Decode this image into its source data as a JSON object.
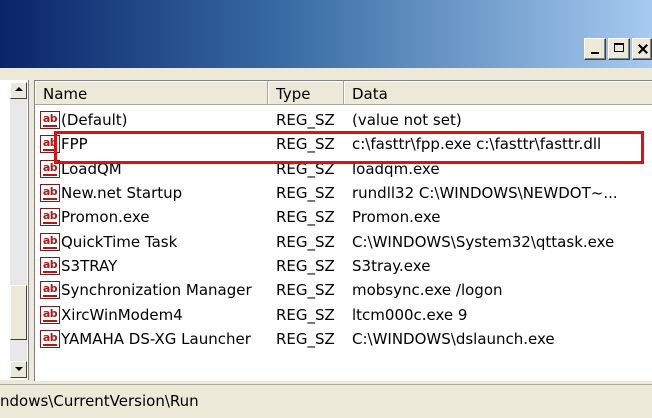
{
  "window": {
    "caption_buttons": [
      "minimize",
      "maximize",
      "close"
    ]
  },
  "list": {
    "columns": [
      "Name",
      "Type",
      "Data"
    ],
    "rows": [
      {
        "name": "(Default)",
        "type": "REG_SZ",
        "data": "(value not set)"
      },
      {
        "name": "FPP",
        "type": "REG_SZ",
        "data": "c:\\fasttr\\fpp.exe c:\\fasttr\\fasttr.dll"
      },
      {
        "name": "LoadQM",
        "type": "REG_SZ",
        "data": "loadqm.exe"
      },
      {
        "name": "New.net Startup",
        "type": "REG_SZ",
        "data": "rundll32 C:\\WINDOWS\\NEWDOT~..."
      },
      {
        "name": "Promon.exe",
        "type": "REG_SZ",
        "data": "Promon.exe"
      },
      {
        "name": "QuickTime Task",
        "type": "REG_SZ",
        "data": "C:\\WINDOWS\\System32\\qttask.exe"
      },
      {
        "name": "S3TRAY",
        "type": "REG_SZ",
        "data": "S3tray.exe"
      },
      {
        "name": "Synchronization Manager",
        "type": "REG_SZ",
        "data": "mobsync.exe /logon"
      },
      {
        "name": "XircWinModem4",
        "type": "REG_SZ",
        "data": "ltcm000c.exe 9"
      },
      {
        "name": "YAMAHA DS-XG Launcher",
        "type": "REG_SZ",
        "data": "C:\\WINDOWS\\dslaunch.exe"
      }
    ],
    "value_icon_text": "ab",
    "highlighted_row": "FPP",
    "highlight_color": "#e01010"
  },
  "statusbar": {
    "path": "ndows\\CurrentVersion\\Run"
  }
}
